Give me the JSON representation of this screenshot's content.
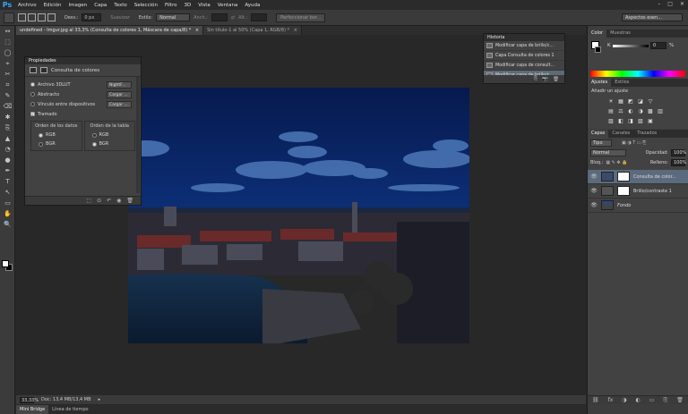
{
  "app": {
    "logo": "Ps"
  },
  "menubar": {
    "items": [
      "Archivo",
      "Edición",
      "Imagen",
      "Capa",
      "Texto",
      "Selección",
      "Filtro",
      "3D",
      "Vista",
      "Ventana",
      "Ayuda"
    ],
    "window_controls": {
      "minimize": "–",
      "maximize": "□",
      "close": "✕"
    }
  },
  "options_bar": {
    "feather_label": "Desv.:",
    "feather_value": "0 px",
    "antialias_label": "Suavizar",
    "style_label": "Estilo:",
    "style_value": "Normal",
    "width_label": "Anch.:",
    "height_label": "Alt.:",
    "refine_button": "Perfeccionar bor...",
    "workspace": "Aspectos esen..."
  },
  "tools": [
    "↔",
    "⬚",
    "◯",
    "⌖",
    "✂",
    "⌗",
    "✎",
    "⌫",
    "✱",
    "⎘",
    "▲",
    "◔",
    "●",
    "✒",
    "T",
    "↖",
    "▭",
    "✋",
    "🔍"
  ],
  "doc_tabs": [
    {
      "label": "undefined - Imgur.jpg al 33,3% (Consulta de colores 1, Máscara de capa/8) *",
      "close": "×",
      "active": true
    },
    {
      "label": "Sin título-1 al 50% (Capa 1, RGB/8) *",
      "close": "×",
      "active": false
    }
  ],
  "status": {
    "zoom": "33,33%",
    "doc": "Doc: 13,4 MB/13,4 MB",
    "arrow": "▸"
  },
  "bottom_tabs": [
    "Mini Bridge",
    "Línea de tiempo"
  ],
  "properties": {
    "header": "Propiedades",
    "title": "Consulta de colores",
    "rows": [
      {
        "label": "Archivo 3DLUT",
        "value": "NightF...",
        "checked": true
      },
      {
        "label": "Abstracto",
        "value": "Cargar ...",
        "checked": false
      },
      {
        "label": "Vínculo entre dispositivos",
        "value": "Cargar ...",
        "checked": false
      }
    ],
    "dither_label": "Tramado",
    "data_order_title": "Orden de los datos",
    "table_order_title": "Orden de la tabla",
    "data_order": [
      "RGB",
      "BGR"
    ],
    "table_order": [
      "RGB",
      "BGR"
    ],
    "footer_icons": [
      "⬚",
      "⊙",
      "↶",
      "◉",
      "🗑"
    ]
  },
  "history": {
    "header": "Historia",
    "items": [
      {
        "label": "Modificar capa de brillo/c...",
        "active": false
      },
      {
        "label": "Capa Consulta de colores 1",
        "active": false
      },
      {
        "label": "Modificar capa de consult...",
        "active": false
      },
      {
        "label": "Modificar capa de brillo/c...",
        "active": true
      }
    ],
    "footer_icons": [
      "⎘",
      "📷",
      "🗑"
    ]
  },
  "color_panel": {
    "tabs": [
      "Color",
      "Muestras"
    ],
    "k_label": "K",
    "k_value": "0",
    "k_unit": "%"
  },
  "adjustments_panel": {
    "tabs": [
      "Ajustes",
      "Estilos"
    ],
    "title": "Añadir un ajuste",
    "icons": [
      "☀",
      "▦",
      "◩",
      "◪",
      "▽",
      "",
      "▤",
      "⚖",
      "◐",
      "◑",
      "▩",
      "▥",
      "▨",
      "◧",
      "◨",
      "▧",
      "▣"
    ]
  },
  "layers_panel": {
    "tabs": [
      "Capas",
      "Canales",
      "Trazados"
    ],
    "kind_label": "Tipo",
    "blend_mode": "Normal",
    "opacity_label": "Opacidad:",
    "opacity_value": "100%",
    "lock_label": "Bloq.:",
    "fill_label": "Relleno:",
    "fill_value": "100%",
    "layers": [
      {
        "name": "Consulta de color...",
        "active": true,
        "thumb": "#3a4a6a"
      },
      {
        "name": "Brillo/contraste 1",
        "active": false,
        "thumb": "#555"
      },
      {
        "name": "Fondo",
        "active": false,
        "thumb": "#2a4a7a"
      }
    ],
    "footer_icons": [
      "⛓",
      "fx",
      "◑",
      "◐",
      "▭",
      "⎘",
      "🗑"
    ]
  }
}
